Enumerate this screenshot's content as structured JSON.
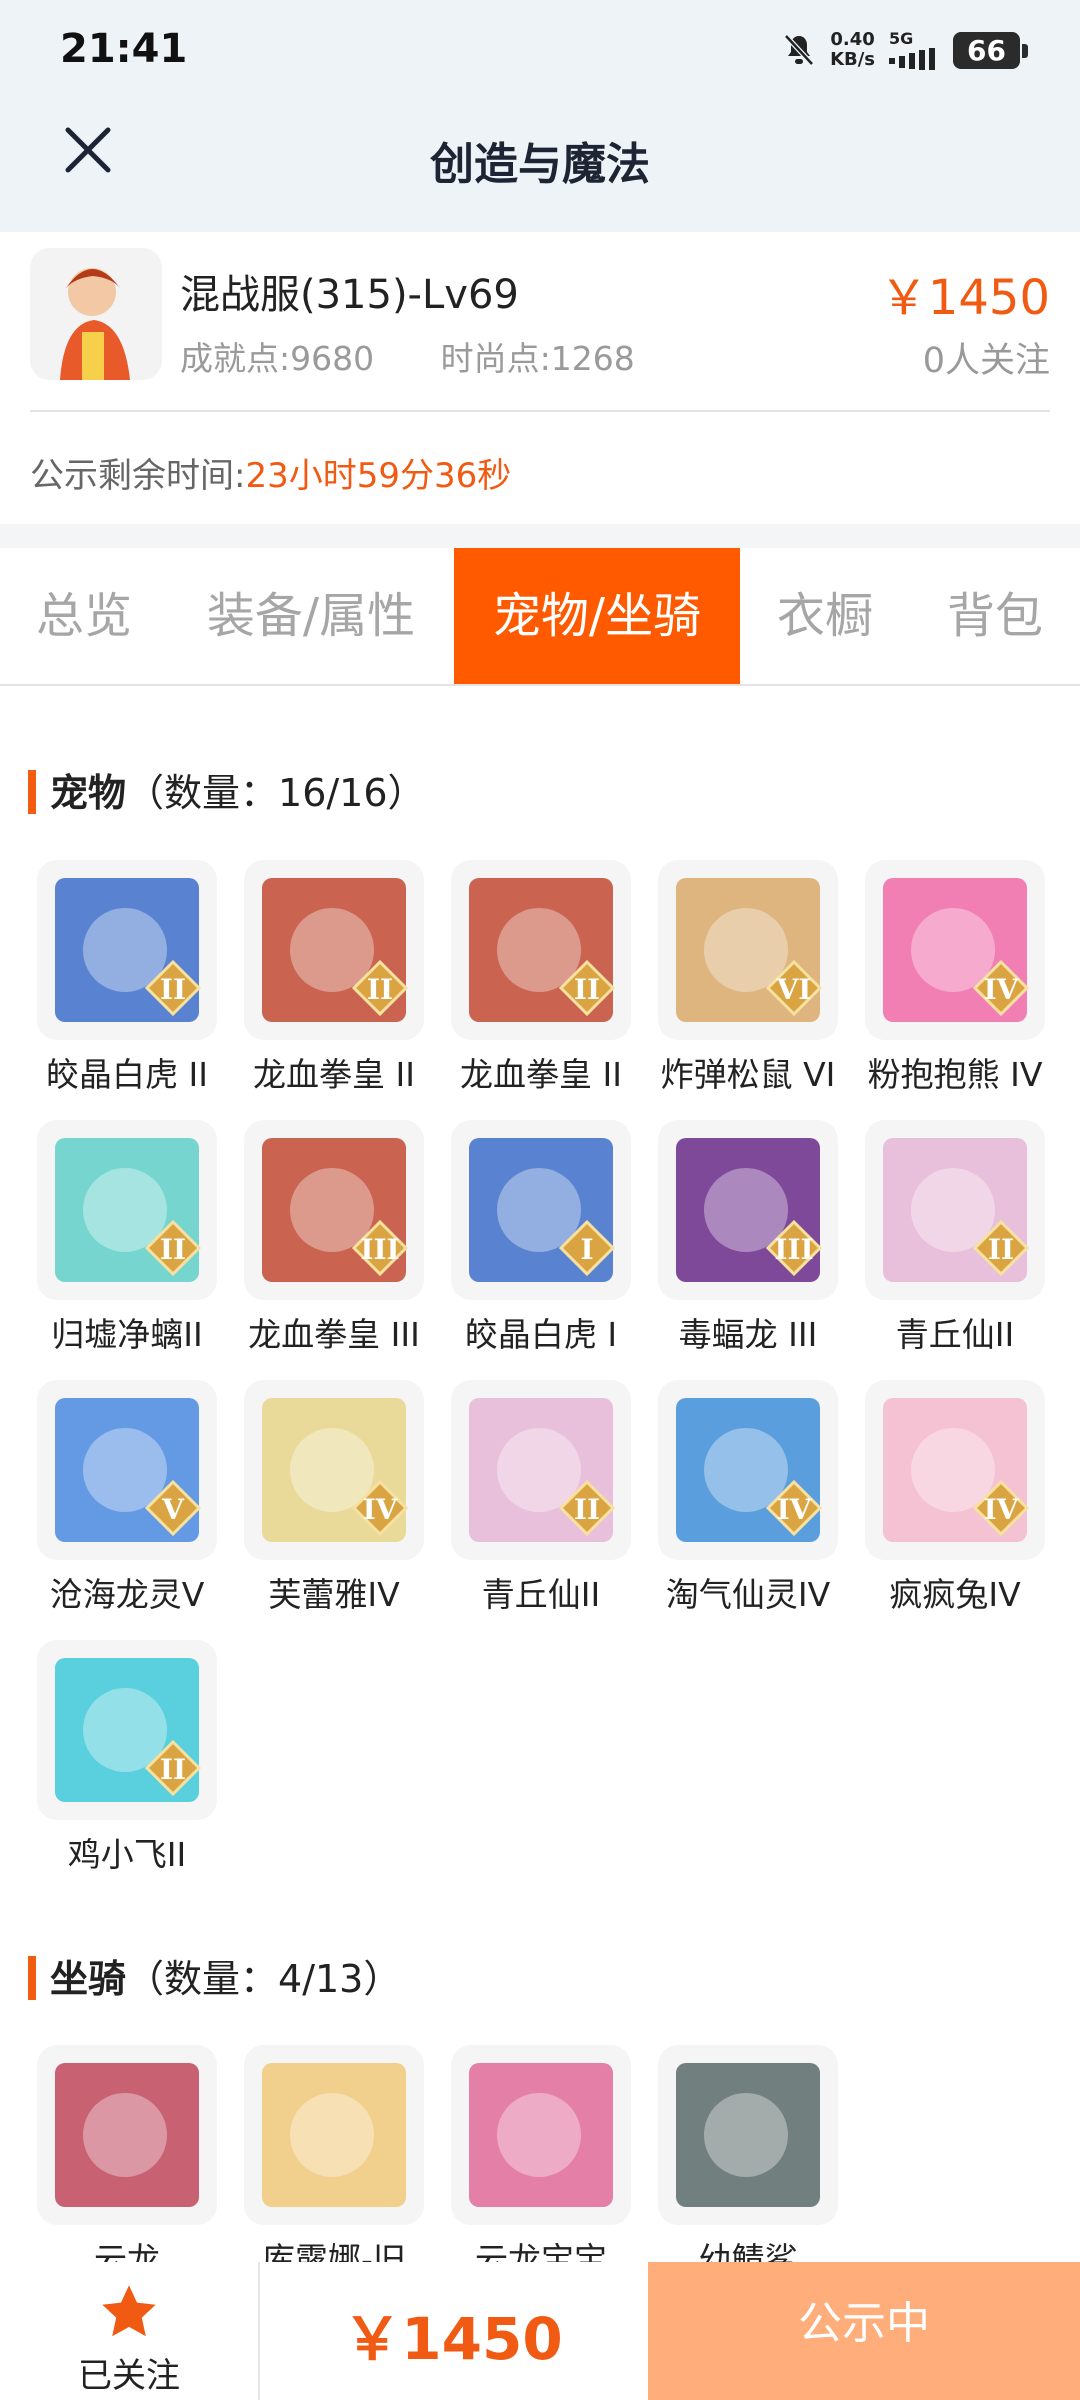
{
  "status_bar": {
    "time": "21:41",
    "net_speed_value": "0.40",
    "net_speed_unit": "KB/s",
    "network": "5G",
    "battery": "66"
  },
  "header": {
    "title": "创造与魔法",
    "close_icon": "close-icon"
  },
  "listing": {
    "server_level": "混战服(315)-Lv69",
    "achievement": "成就点:9680",
    "fashion": "时尚点:1268",
    "price": "￥1450",
    "followers": "0人关注",
    "countdown_label": "公示剩余时间:",
    "countdown_value": "23小时59分36秒"
  },
  "tabs": [
    {
      "label": "总览",
      "active": false
    },
    {
      "label": "装备/属性",
      "active": false
    },
    {
      "label": "宠物/坐骑",
      "active": true
    },
    {
      "label": "衣橱",
      "active": false
    },
    {
      "label": "背包",
      "active": false
    }
  ],
  "pets": {
    "title": "宠物",
    "count": "（数量：16/16）",
    "items": [
      {
        "name": "皎晶白虎 II",
        "rank": "II",
        "color": "#3d6fc9"
      },
      {
        "name": "龙血拳皇 II",
        "rank": "II",
        "color": "#c24a32"
      },
      {
        "name": "龙血拳皇 II",
        "rank": "II",
        "color": "#c24a32"
      },
      {
        "name": "炸弹松鼠 VI",
        "rank": "VI",
        "color": "#d9a86a"
      },
      {
        "name": "粉抱抱熊 IV",
        "rank": "IV",
        "color": "#f06aa8"
      },
      {
        "name": "归墟净螭II",
        "rank": "II",
        "color": "#5fd0c8"
      },
      {
        "name": "龙血拳皇 III",
        "rank": "III",
        "color": "#c24a32"
      },
      {
        "name": "皎晶白虎 I",
        "rank": "I",
        "color": "#3d6fc9"
      },
      {
        "name": "毒蝠龙 III",
        "rank": "III",
        "color": "#6a2a8a"
      },
      {
        "name": "青丘仙II",
        "rank": "II",
        "color": "#e6b6d6"
      },
      {
        "name": "沧海龙灵V",
        "rank": "V",
        "color": "#4a8ae0"
      },
      {
        "name": "芙蕾雅IV",
        "rank": "IV",
        "color": "#e8d58a"
      },
      {
        "name": "青丘仙II",
        "rank": "II",
        "color": "#e6b6d6"
      },
      {
        "name": "淘气仙灵IV",
        "rank": "IV",
        "color": "#3f8ed8"
      },
      {
        "name": "疯疯兔IV",
        "rank": "IV",
        "color": "#f3b9cd"
      },
      {
        "name": "鸡小飞II",
        "rank": "II",
        "color": "#3ec8d8"
      }
    ]
  },
  "mounts": {
    "title": "坐骑",
    "count": "（数量：4/13）",
    "items": [
      {
        "name": "云龙",
        "color": "#c0485c"
      },
      {
        "name": "库露娜-旧",
        "color": "#f0c87a"
      },
      {
        "name": "云龙宝宝",
        "color": "#e06a9a"
      },
      {
        "name": "幼鲭鲨",
        "color": "#5a6a6a"
      }
    ]
  },
  "bottom_bar": {
    "follow_label": "已关注",
    "price": "￥1450",
    "status_button": "公示中"
  }
}
